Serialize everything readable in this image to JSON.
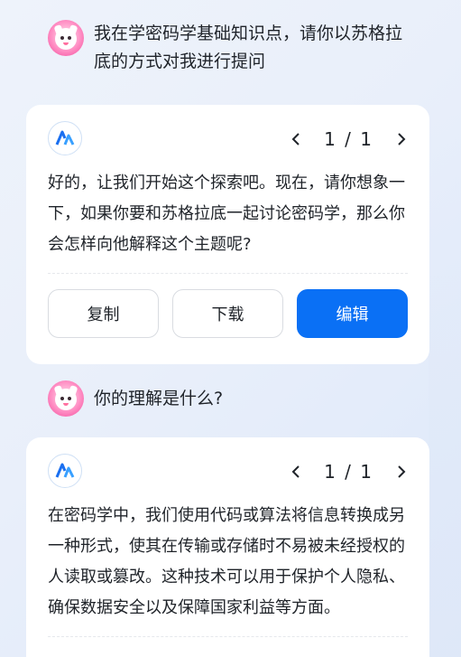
{
  "conversation": [
    {
      "role": "user",
      "text": "我在学密码学基础知识点，请你以苏格拉底的方式对我进行提问"
    },
    {
      "role": "assistant",
      "pager": "1 / 1",
      "text": "好的，让我们开始这个探索吧。现在，请你想象一下，如果你要和苏格拉底一起讨论密码学，那么你会怎样向他解释这个主题呢?",
      "actions": {
        "copy": "复制",
        "download": "下载",
        "edit": "编辑"
      }
    },
    {
      "role": "user",
      "text": "你的理解是什么?"
    },
    {
      "role": "assistant",
      "pager": "1 / 1",
      "text": "在密码学中，我们使用代码或算法将信息转换成另一种形式，使其在传输或存储时不易被未经授权的人读取或篡改。这种技术可以用于保护个人隐私、确保数据安全以及保障国家利益等方面。"
    }
  ],
  "colors": {
    "accent": "#0a70f5",
    "background": "#e9effa"
  },
  "icons": {
    "user_avatar": "cat-avatar-icon",
    "bot": "bot-logo-icon",
    "prev": "chevron-left-icon",
    "next": "chevron-right-icon"
  }
}
